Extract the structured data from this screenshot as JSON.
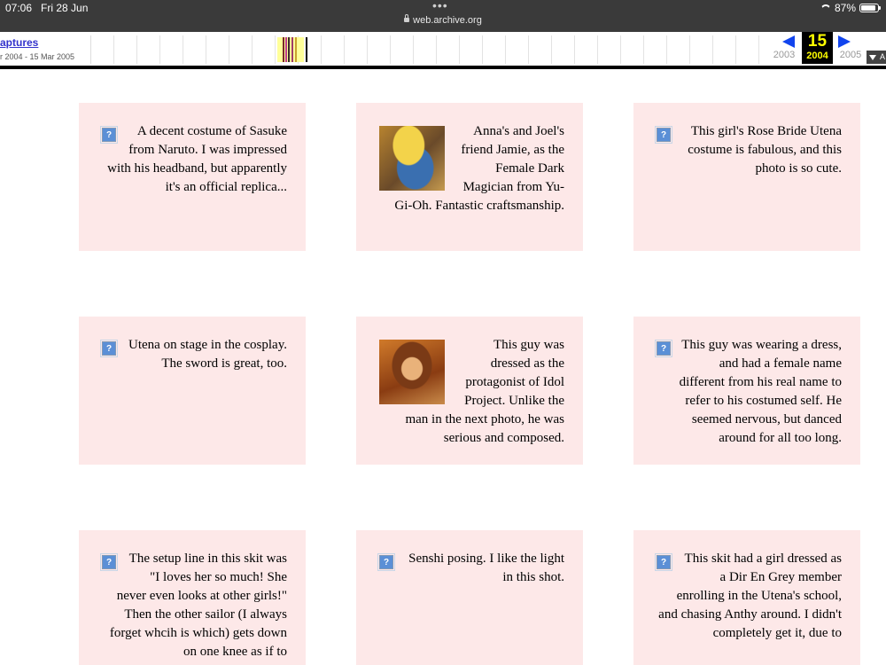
{
  "status_bar": {
    "time": "07:06",
    "date": "Fri 28 Jun",
    "url": "web.archive.org",
    "battery": "87%",
    "battery_level": 0.87
  },
  "wayback": {
    "captures_label": "aptures",
    "captures_range": "r 2004 - 15 Mar 2005",
    "prev_year": "2003",
    "current_day": "15",
    "current_year": "2004",
    "next_year": "2005",
    "about_label": "A"
  },
  "colors": {
    "card_background": "#fde8e8",
    "link_blue": "#3333cc",
    "current_year_highlight": "#ffff00"
  },
  "cards": [
    {
      "caption": "A decent costume of Sasuke from Naruto. I was impressed with his headband, but apparently it's an official replica...",
      "image": "broken-image-icon"
    },
    {
      "caption": "Anna's and Joel's friend Jamie, as the Female Dark Magician from Yu-Gi-Oh. Fantastic craftsmanship.",
      "image": "photo-thumbnail"
    },
    {
      "caption": "This girl's Rose Bride Utena costume is fabulous, and this photo is so cute.",
      "image": "broken-image-icon"
    },
    {
      "caption": "Utena on stage in the cosplay. The sword is great, too.",
      "image": "broken-image-icon"
    },
    {
      "caption": "This guy was dressed as the protagonist of Idol Project. Unlike the man in the next photo, he was serious and composed.",
      "image": "photo-thumbnail"
    },
    {
      "caption": "This guy was wearing a dress, and had a female name different from his real name to refer to his costumed self. He seemed nervous, but danced around for all too long.",
      "image": "broken-image-icon"
    },
    {
      "caption": "The setup line in this skit was \"I loves her so much! She never even looks at other girls!\" Then the other sailor (I always forget whcih is which) gets down on one knee as if to",
      "image": "broken-image-icon"
    },
    {
      "caption": "Senshi posing. I like the light in this shot.",
      "image": "broken-image-icon"
    },
    {
      "caption": "This skit had a girl dressed as a Dir En Grey member enrolling in the Utena's school, and chasing Anthy around. I didn't completely get it, due to",
      "image": "broken-image-icon"
    }
  ]
}
